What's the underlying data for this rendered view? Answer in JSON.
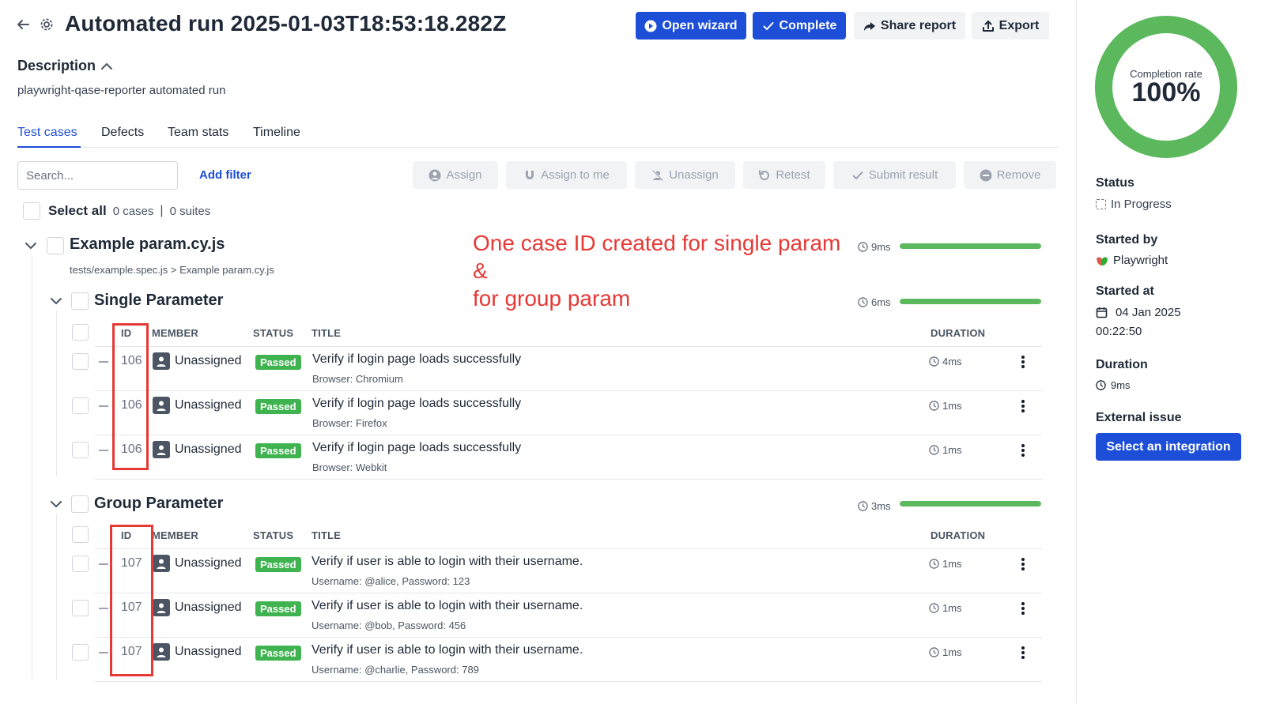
{
  "header": {
    "title": "Automated run 2025-01-03T18:53:18.282Z",
    "buttons": {
      "open_wizard": "Open wizard",
      "complete": "Complete",
      "share_report": "Share report",
      "export": "Export"
    }
  },
  "description": {
    "label": "Description",
    "text": "playwright-qase-reporter automated run"
  },
  "tabs": [
    "Test cases",
    "Defects",
    "Team stats",
    "Timeline"
  ],
  "toolbar": {
    "search_placeholder": "Search...",
    "add_filter": "Add filter",
    "assign": "Assign",
    "assign_to_me": "Assign to me",
    "unassign": "Unassign",
    "retest": "Retest",
    "submit_result": "Submit result",
    "remove": "Remove"
  },
  "select_all": {
    "label": "Select all",
    "cases": "0 cases",
    "suites": "0 suites"
  },
  "root_suite": {
    "title": "Example param.cy.js",
    "path": "tests/example.spec.js > Example param.cy.js",
    "duration": "9ms",
    "progress": 1.0
  },
  "annotation": {
    "line1": "One case ID created for single param",
    "line2": "&",
    "line3": "for group param"
  },
  "columns": {
    "id": "ID",
    "member": "MEMBER",
    "status": "STATUS",
    "title": "TITLE",
    "duration": "DURATION"
  },
  "suites": [
    {
      "title": "Single Parameter",
      "duration": "6ms",
      "progress": 1.0,
      "rows": [
        {
          "id": "106",
          "member": "Unassigned",
          "status": "Passed",
          "title": "Verify if login page loads successfully",
          "sub": "Browser: Chromium",
          "duration": "4ms"
        },
        {
          "id": "106",
          "member": "Unassigned",
          "status": "Passed",
          "title": "Verify if login page loads successfully",
          "sub": "Browser: Firefox",
          "duration": "1ms"
        },
        {
          "id": "106",
          "member": "Unassigned",
          "status": "Passed",
          "title": "Verify if login page loads successfully",
          "sub": "Browser: Webkit",
          "duration": "1ms"
        }
      ]
    },
    {
      "title": "Group Parameter",
      "duration": "3ms",
      "progress": 1.0,
      "rows": [
        {
          "id": "107",
          "member": "Unassigned",
          "status": "Passed",
          "title": "Verify if user is able to login with their username.",
          "sub": "Username: @alice, Password: 123",
          "duration": "1ms"
        },
        {
          "id": "107",
          "member": "Unassigned",
          "status": "Passed",
          "title": "Verify if user is able to login with their username.",
          "sub": "Username: @bob, Password: 456",
          "duration": "1ms"
        },
        {
          "id": "107",
          "member": "Unassigned",
          "status": "Passed",
          "title": "Verify if user is able to login with their username.",
          "sub": "Username: @charlie, Password: 789",
          "duration": "1ms"
        }
      ]
    }
  ],
  "sidebar": {
    "completion_label": "Completion rate",
    "completion_value": "100%",
    "completion_fraction": 1.0,
    "status_label": "Status",
    "status_value": "In Progress",
    "started_by_label": "Started by",
    "started_by_value": "Playwright",
    "started_at_label": "Started at",
    "started_at_date": "04 Jan 2025",
    "started_at_time": "00:22:50",
    "duration_label": "Duration",
    "duration_value": "9ms",
    "external_issue_label": "External issue",
    "select_integration": "Select an integration"
  },
  "colors": {
    "primary": "#1d4ed8",
    "success": "#3fb34f",
    "progress": "#5cb85c",
    "annotation": "#e53935"
  }
}
